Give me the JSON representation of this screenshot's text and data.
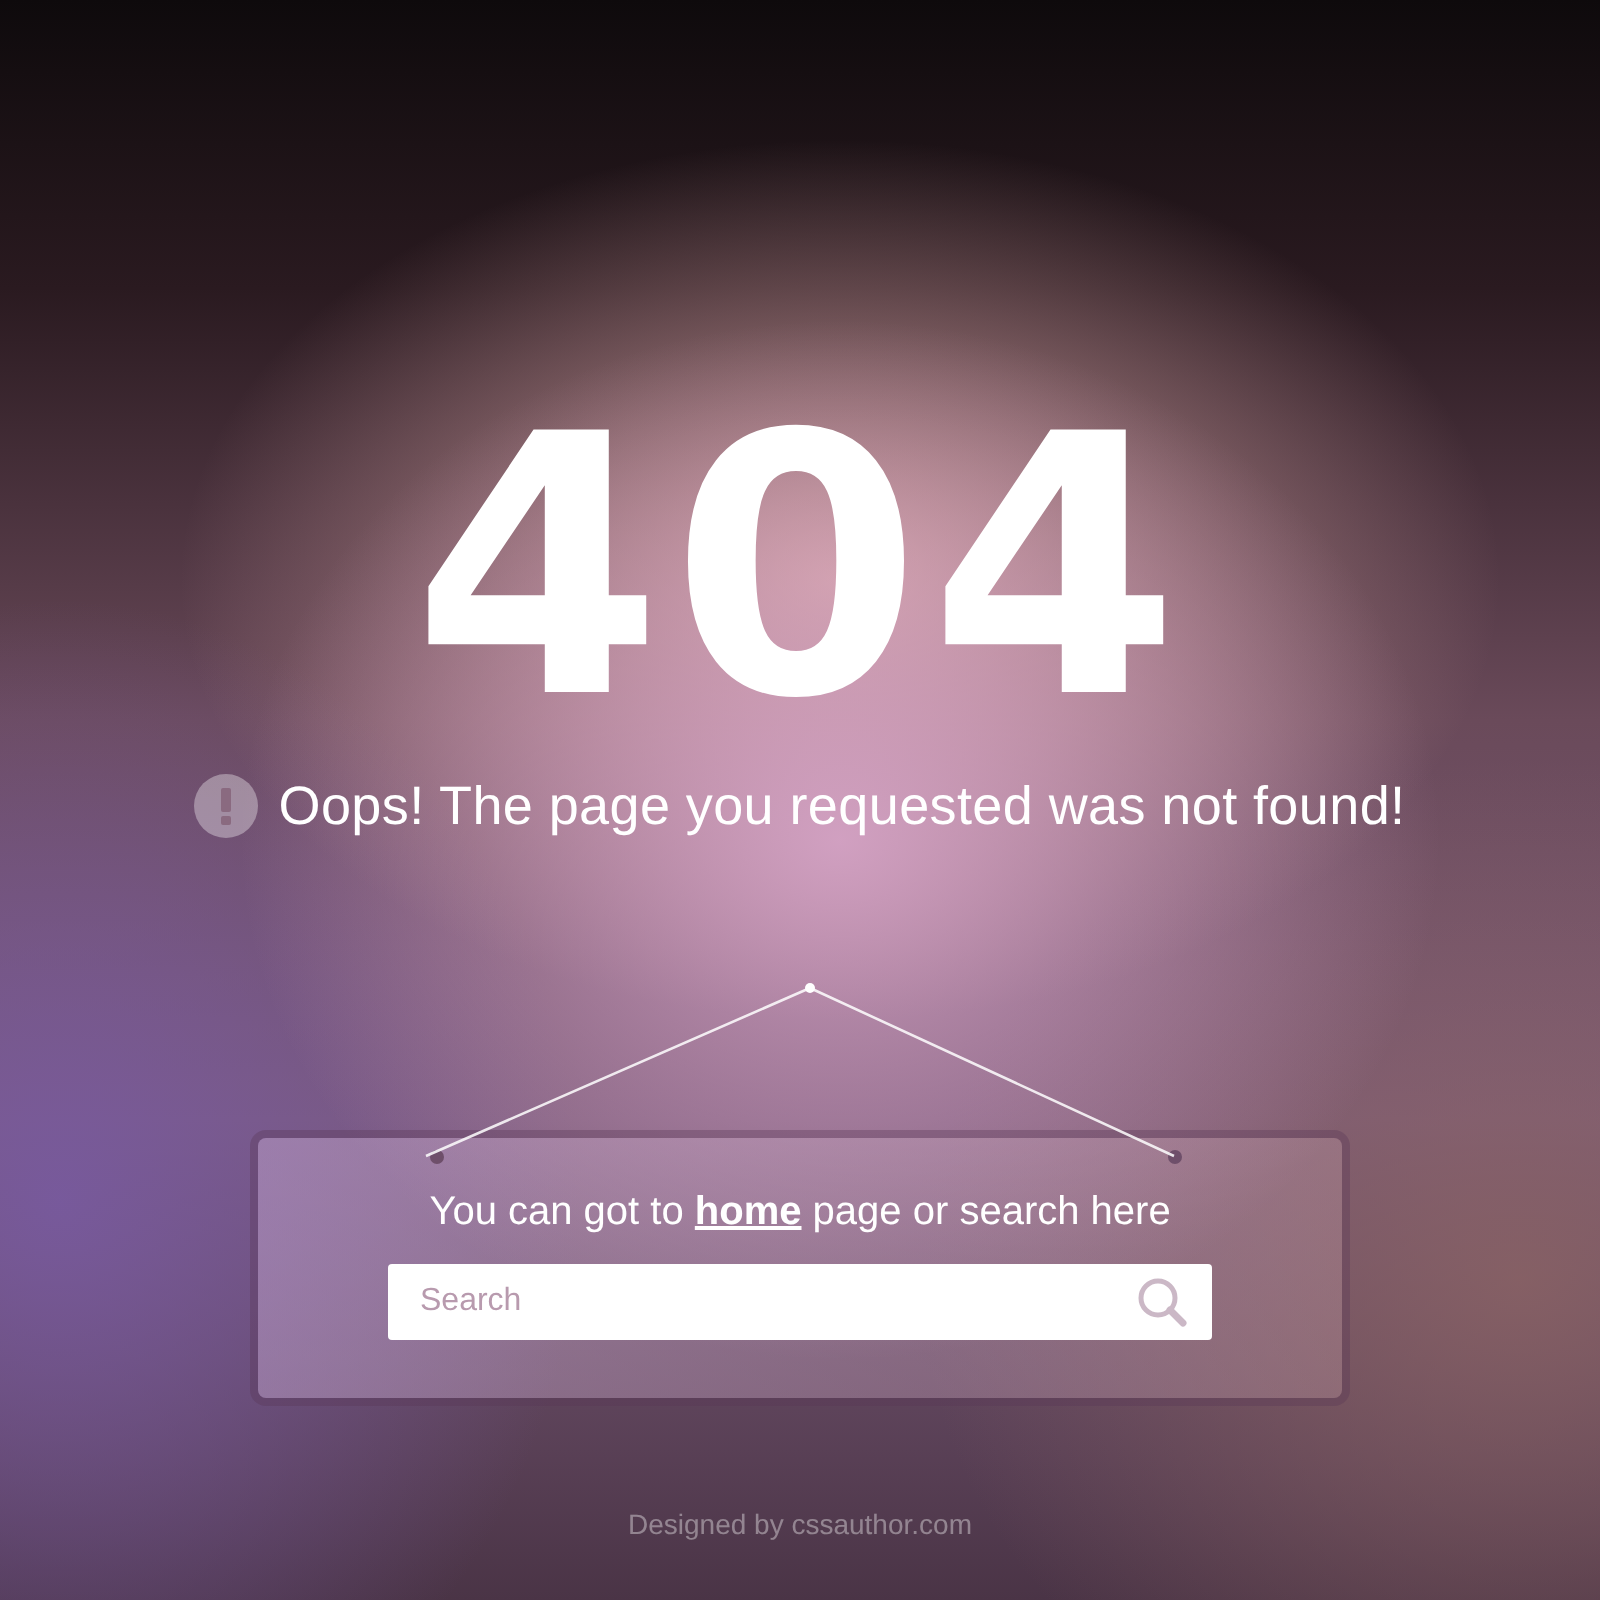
{
  "error_code": "404",
  "message": "Oops! The page you requested was not found!",
  "card": {
    "text_before": "You can got to ",
    "link": "home",
    "text_after": " page or search here"
  },
  "search": {
    "placeholder": "Search"
  },
  "footer": "Designed by cssauthor.com"
}
